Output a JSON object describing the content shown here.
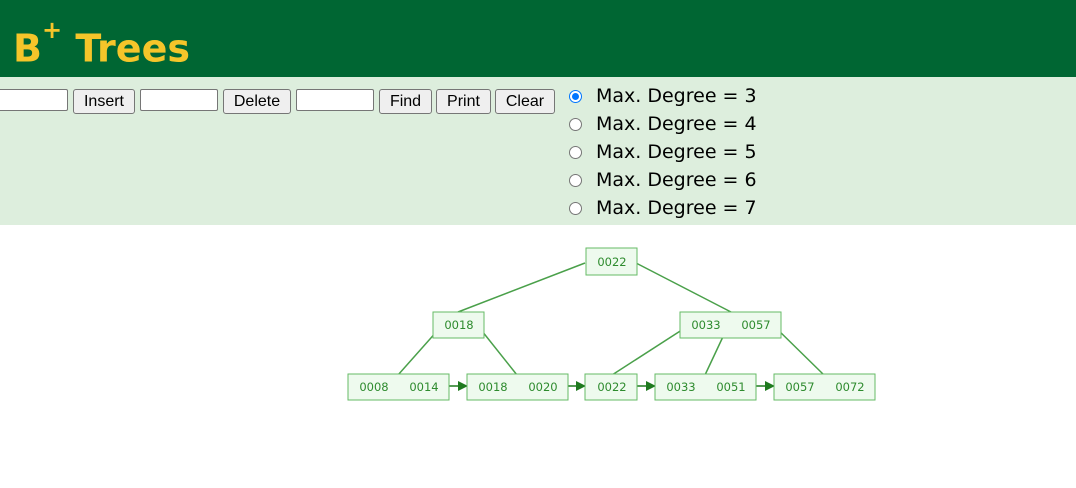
{
  "header": {
    "title": "B",
    "title_sup": "+",
    "title_rest": "Trees"
  },
  "controls": {
    "insert_value": "",
    "insert_label": "Insert",
    "delete_value": "",
    "delete_label": "Delete",
    "find_value": "",
    "find_label": "Find",
    "print_label": "Print",
    "clear_label": "Clear"
  },
  "degree_options": [
    {
      "label": "Max. Degree = 3",
      "checked": true
    },
    {
      "label": "Max. Degree = 4",
      "checked": false
    },
    {
      "label": "Max. Degree = 5",
      "checked": false
    },
    {
      "label": "Max. Degree = 6",
      "checked": false
    },
    {
      "label": "Max. Degree = 7",
      "checked": false
    }
  ],
  "tree": {
    "root": {
      "keys": [
        "0022"
      ]
    },
    "internal": [
      {
        "keys": [
          "0018"
        ]
      },
      {
        "keys": [
          "0033",
          "0057"
        ]
      }
    ],
    "leaves": [
      {
        "keys": [
          "0008",
          "0014"
        ]
      },
      {
        "keys": [
          "0018",
          "0020"
        ]
      },
      {
        "keys": [
          "0022"
        ]
      },
      {
        "keys": [
          "0033",
          "0051"
        ]
      },
      {
        "keys": [
          "0057",
          "0072"
        ]
      }
    ]
  },
  "colors": {
    "header_bg": "#006633",
    "title": "#f5c52a",
    "controls_bg": "#ddeedd",
    "node_fill": "#eefaee",
    "node_stroke": "#66bb66",
    "edge": "#4aa04a",
    "arrow": "#1f7a1f"
  }
}
